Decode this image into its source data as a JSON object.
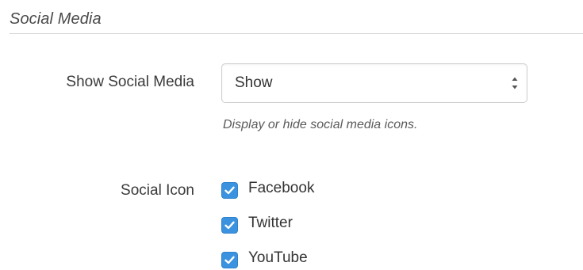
{
  "section": {
    "title": "Social Media"
  },
  "show_social_media": {
    "label": "Show Social Media",
    "selected": "Show",
    "help_text": "Display or hide social media icons."
  },
  "social_icon": {
    "label": "Social Icon",
    "options": [
      {
        "label": "Facebook",
        "checked": true
      },
      {
        "label": "Twitter",
        "checked": true
      },
      {
        "label": "YouTube",
        "checked": true
      }
    ]
  },
  "colors": {
    "checkbox_fill": "#3b93e0",
    "divider": "#d4d4d4"
  },
  "icons": {
    "select_arrows": "up-down-chevron-icon",
    "checkmark": "checkmark-icon"
  }
}
